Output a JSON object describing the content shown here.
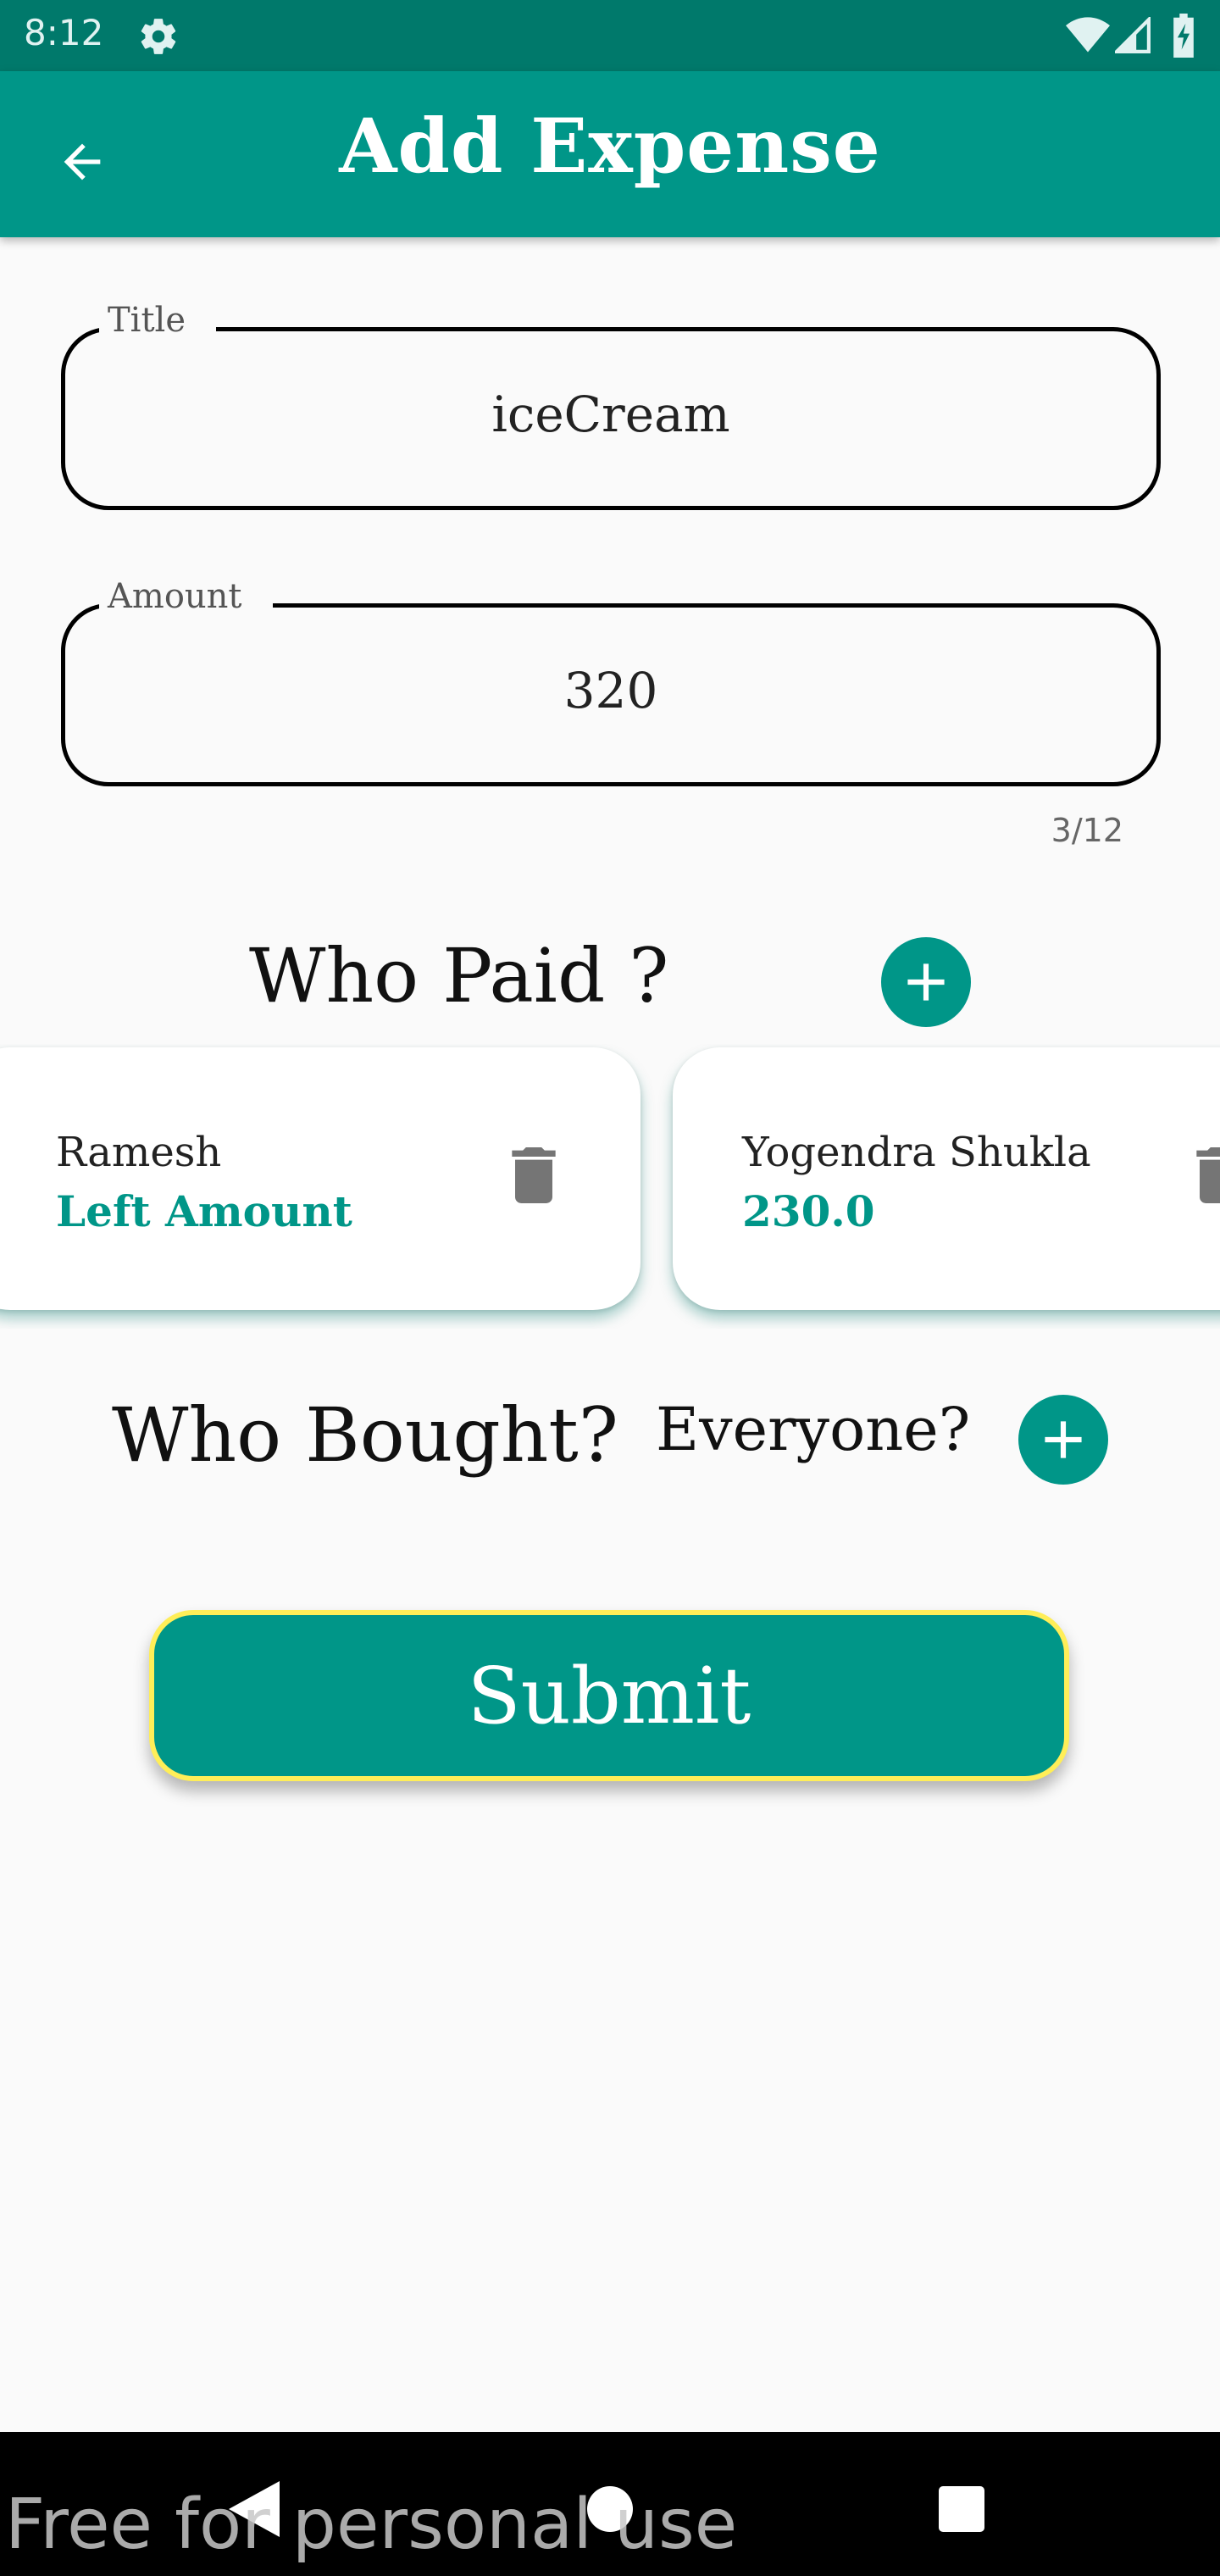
{
  "status_bar": {
    "time": "8:12",
    "icons": [
      "gear-icon",
      "wifi-icon",
      "signal-icon",
      "battery-charging-icon"
    ]
  },
  "app_bar": {
    "title": "Add Expense",
    "back_icon": "arrow-back-icon",
    "color": "#009688"
  },
  "form": {
    "title_field": {
      "label": "Title",
      "value": "iceCream"
    },
    "amount_field": {
      "label": "Amount",
      "value": "320",
      "counter": "3/12"
    }
  },
  "who_paid": {
    "heading": "Who Paid ?",
    "add_icon": "add-circle-icon",
    "payers": [
      {
        "name": "Ramesh",
        "amount": "Left Amount",
        "delete_icon": "trash-icon"
      },
      {
        "name": "Yogendra Shukla",
        "amount": "230.0",
        "delete_icon": "trash-icon"
      }
    ]
  },
  "who_bought": {
    "heading": "Who Bought?",
    "everyone_label": "Everyone?",
    "add_icon": "add-circle-icon"
  },
  "submit": {
    "label": "Submit",
    "border_color": "#ffee58"
  },
  "nav_bar": {
    "icons": [
      "nav-back-icon",
      "nav-home-icon",
      "nav-recents-icon"
    ]
  },
  "watermark": "Free for personal use"
}
